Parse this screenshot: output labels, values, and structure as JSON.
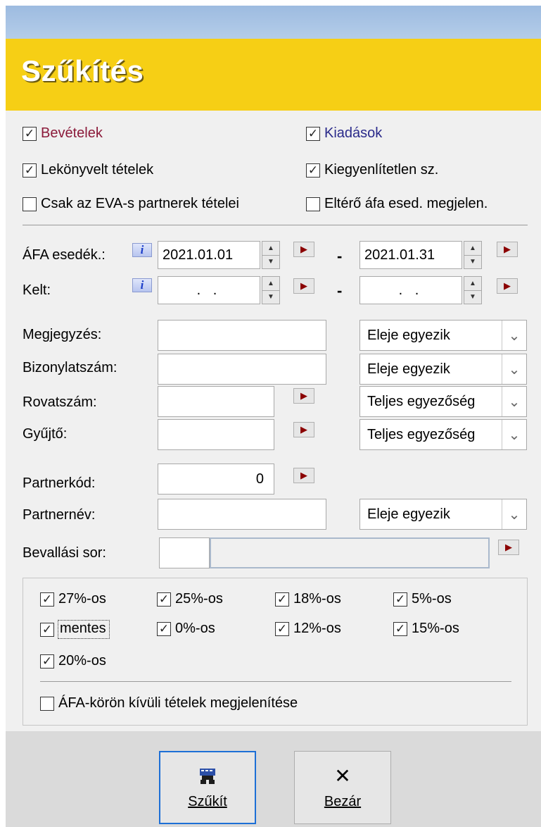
{
  "banner": {
    "title": "Szűkítés"
  },
  "options": {
    "bevetelek": {
      "label": "Bevételek",
      "checked": true,
      "color": "#8b1a3a"
    },
    "kiadasok": {
      "label": "Kiadások",
      "checked": true,
      "color": "#2a2a8a"
    },
    "lekonyvelt": {
      "label": "Lekönyvelt tételek",
      "checked": true
    },
    "kiegyenlitetlen": {
      "label": "Kiegyenlítetlen sz.",
      "checked": true
    },
    "eva": {
      "label": "Csak az EVA-s partnerek tételei",
      "checked": false
    },
    "eltero": {
      "label": "Eltérő áfa esed. megjelen.",
      "checked": false
    }
  },
  "dates": {
    "afa": {
      "label": "ÁFA esedék.:",
      "from": "2021.01.01",
      "to": "2021.01.31"
    },
    "kelt": {
      "label": "Kelt:",
      "from": ". .",
      "to": ". ."
    },
    "separator": "-",
    "info_glyph": "i"
  },
  "fields": {
    "megjegyzes": {
      "label": "Megjegyzés:",
      "value": "",
      "match": "Eleje egyezik"
    },
    "bizonylatszam": {
      "label": "Bizonylatszám:",
      "value": "",
      "match": "Eleje egyezik"
    },
    "rovatszam": {
      "label": "Rovatszám:",
      "value": "",
      "match": "Teljes egyezőség"
    },
    "gyujto": {
      "label": "Gyűjtő:",
      "value": "",
      "match": "Teljes egyezőség"
    },
    "partnerkod": {
      "label": "Partnerkód:",
      "value": "0"
    },
    "partnernev": {
      "label": "Partnernév:",
      "value": "",
      "match": "Eleje egyezik"
    },
    "bevallasi_sor": {
      "label": "Bevallási sor:",
      "value": ""
    }
  },
  "vat_rates": [
    {
      "label": "27%-os",
      "checked": true
    },
    {
      "label": "25%-os",
      "checked": true
    },
    {
      "label": "18%-os",
      "checked": true
    },
    {
      "label": "5%-os",
      "checked": true
    },
    {
      "label": "mentes",
      "checked": true
    },
    {
      "label": "0%-os",
      "checked": true
    },
    {
      "label": "12%-os",
      "checked": true
    },
    {
      "label": "15%-os",
      "checked": true
    },
    {
      "label": "20%-os",
      "checked": true
    }
  ],
  "afa_outside": {
    "label": "ÁFA-körön kívüli tételek megjelenítése",
    "checked": false
  },
  "buttons": {
    "szukit": "Szűkít",
    "bezar": "Bezár"
  },
  "icons": {
    "check": "✓",
    "arrow": "▶",
    "chevron": "⌄",
    "close": "✕",
    "spin_up": "▲",
    "spin_down": "▼"
  }
}
